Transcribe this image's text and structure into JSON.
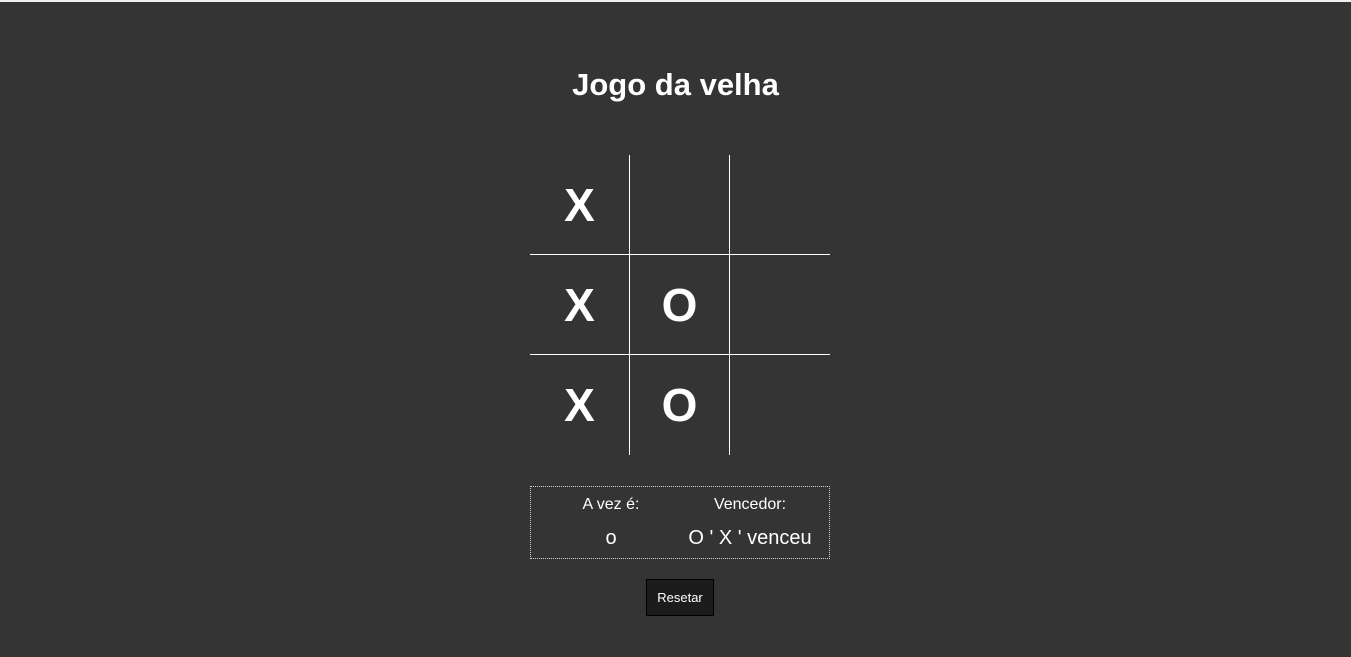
{
  "page": {
    "title": "Jogo da velha"
  },
  "board": {
    "cells": [
      "X",
      "",
      "",
      "X",
      "O",
      "",
      "X",
      "O",
      ""
    ]
  },
  "status": {
    "turn_label": "A vez é:",
    "turn_value": "o",
    "winner_label": "Vencedor:",
    "winner_value": "O ' X ' venceu"
  },
  "controls": {
    "reset_label": "Resetar"
  },
  "colors": {
    "background": "#343434",
    "foreground": "#ffffff",
    "button_background": "#1c1c1c"
  }
}
